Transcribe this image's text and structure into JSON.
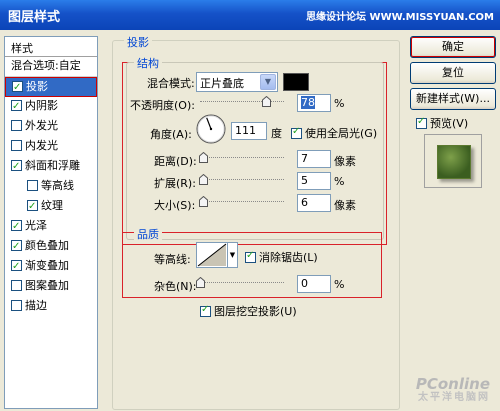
{
  "window": {
    "title": "图层样式",
    "watermark": "思缘设计论坛 WWW.MISSYUAN.COM"
  },
  "style_list": {
    "header": "样式",
    "items": [
      {
        "label": "混合选项:自定",
        "checkbox": false,
        "checked": false
      },
      {
        "label": "投影",
        "checkbox": true,
        "checked": true,
        "selected": true
      },
      {
        "label": "内阴影",
        "checkbox": true,
        "checked": true
      },
      {
        "label": "外发光",
        "checkbox": true,
        "checked": false
      },
      {
        "label": "内发光",
        "checkbox": true,
        "checked": false
      },
      {
        "label": "斜面和浮雕",
        "checkbox": true,
        "checked": true
      },
      {
        "label": "等高线",
        "checkbox": true,
        "checked": false,
        "sub": true
      },
      {
        "label": "纹理",
        "checkbox": true,
        "checked": true,
        "sub": true
      },
      {
        "label": "光泽",
        "checkbox": true,
        "checked": true
      },
      {
        "label": "颜色叠加",
        "checkbox": true,
        "checked": true
      },
      {
        "label": "渐变叠加",
        "checkbox": true,
        "checked": true
      },
      {
        "label": "图案叠加",
        "checkbox": true,
        "checked": false
      },
      {
        "label": "描边",
        "checkbox": true,
        "checked": false
      }
    ]
  },
  "drop_shadow": {
    "title": "投影",
    "structure": {
      "title": "结构",
      "blend_mode_label": "混合模式:",
      "blend_mode_value": "正片叠底",
      "shadow_color": "#000000",
      "opacity_label": "不透明度(O):",
      "opacity_value": "78",
      "opacity_unit": "%",
      "opacity_fraction": 0.78,
      "angle_label": "角度(A):",
      "angle_value": "111",
      "angle_unit": "度",
      "global_light_label": "使用全局光(G)",
      "global_light_checked": true,
      "distance_label": "距离(D):",
      "distance_value": "7",
      "distance_unit": "像素",
      "spread_label": "扩展(R):",
      "spread_value": "5",
      "spread_unit": "%",
      "size_label": "大小(S):",
      "size_value": "6",
      "size_unit": "像素"
    },
    "quality": {
      "title": "品质",
      "contour_label": "等高线:",
      "antialias_label": "消除锯齿(L)",
      "antialias_checked": true,
      "noise_label": "杂色(N):",
      "noise_value": "0",
      "noise_unit": "%"
    },
    "knockout_label": "图层挖空投影(U)",
    "knockout_checked": true
  },
  "buttons": {
    "ok": "确定",
    "reset": "复位",
    "new_style": "新建样式(W)...",
    "preview_label": "预览(V)",
    "preview_checked": true
  },
  "logo": {
    "brand": "PConline",
    "sub": "太平洋电脑网"
  }
}
